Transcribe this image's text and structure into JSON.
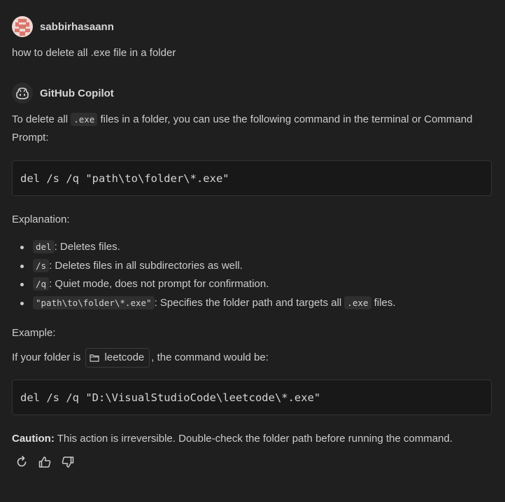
{
  "user": {
    "name": "sabbirhasaann",
    "message": "how to delete all .exe file in a folder"
  },
  "assistant": {
    "name": "GitHub Copilot",
    "intro_prefix": "To delete all ",
    "intro_code": ".exe",
    "intro_suffix": " files in a folder, you can use the following command in the terminal or Command Prompt:",
    "command1": "del /s /q \"path\\to\\folder\\*.exe\"",
    "explanation_label": "Explanation:",
    "bullets": [
      {
        "code": "del",
        "text": ": Deletes files."
      },
      {
        "code": "/s",
        "text": ": Deletes files in all subdirectories as well."
      },
      {
        "code": "/q",
        "text": ": Quiet mode, does not prompt for confirmation."
      },
      {
        "code": "\"path\\to\\folder\\*.exe\"",
        "text": ": Specifies the folder path and targets all ",
        "code2": ".exe",
        "text2": " files."
      }
    ],
    "example_label": "Example:",
    "example_prefix": "If your folder is ",
    "folder_name": "leetcode",
    "example_suffix": ", the command would be:",
    "command2": "del /s /q \"D:\\VisualStudioCode\\leetcode\\*.exe\"",
    "caution_label": "Caution:",
    "caution_text": " This action is irreversible. Double-check the folder path before running the command."
  },
  "icons": {
    "retry": "retry-icon",
    "thumbs_up": "thumbs-up-icon",
    "thumbs_down": "thumbs-down-icon",
    "folder": "folder-icon",
    "copilot": "copilot-icon"
  },
  "colors": {
    "background": "#1f1f1f",
    "text": "#cccccc",
    "codeblock_bg": "#181818",
    "inline_code_bg": "#2f2f2f",
    "avatar_bg": "#f1d6d3",
    "avatar_fg": "#d9776c"
  }
}
